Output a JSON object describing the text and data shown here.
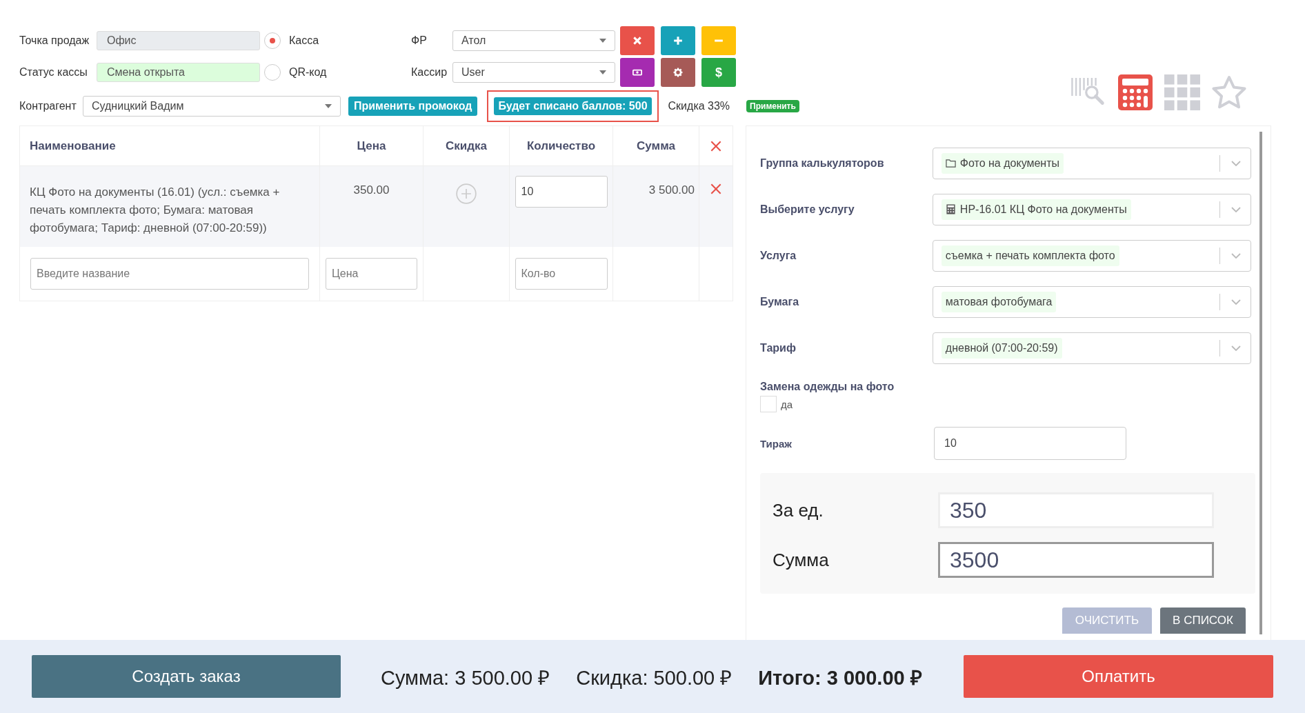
{
  "point_of_sale": {
    "label": "Точка продаж",
    "value": "Офис"
  },
  "register_status": {
    "label": "Статус кассы",
    "value": "Смена открыта"
  },
  "payment_modes": [
    {
      "label": "Касса",
      "selected": true
    },
    {
      "label": "QR-код",
      "selected": false
    }
  ],
  "fiscal": {
    "label": "ФР",
    "value": "Атол"
  },
  "cashier": {
    "label": "Кассир",
    "value": "User"
  },
  "tool_buttons": [
    {
      "kind": "close",
      "color": "#e8524a"
    },
    {
      "kind": "plus",
      "color": "#17a2b8"
    },
    {
      "kind": "minus",
      "color": "#ffc107"
    },
    {
      "kind": "cash",
      "color": "#a52bb0"
    },
    {
      "kind": "gear",
      "color": "#a65a57"
    },
    {
      "kind": "text",
      "label": "$",
      "color": "#28a745"
    }
  ],
  "counterparty": {
    "label": "Контрагент",
    "value": "Судницкий Вадим"
  },
  "promo_button": "Применить промокод",
  "points_badge": "Будет списано баллов: 500",
  "discount_text": "Скидка 33%",
  "apply_button": "Применить",
  "view_icons": [
    {
      "kind": "barcode-search",
      "selected": false
    },
    {
      "kind": "calculator",
      "selected": true
    },
    {
      "kind": "grid",
      "selected": false
    },
    {
      "kind": "star",
      "selected": false
    }
  ],
  "table": {
    "columns": [
      "Наименование",
      "Цена",
      "Скидка",
      "Количество",
      "Сумма"
    ],
    "rows": [
      {
        "name": "КЦ Фото на документы (16.01) (усл.: съемка + печать комплекта фото; Бумага: матовая фотобумага; Тариф: дневной (07:00-20:59))",
        "price": "350.00",
        "quantity": "10",
        "sum": "3 500.00"
      }
    ],
    "new_row": {
      "name_placeholder": "Введите название",
      "price_placeholder": "Цена",
      "quantity_placeholder": "Кол-во"
    }
  },
  "calculator": {
    "fields": [
      {
        "label": "Группа калькуляторов",
        "value": "Фото на документы",
        "kind": "folder"
      },
      {
        "label": "Выберите услугу",
        "value": "НР-16.01 КЦ Фото на документы",
        "kind": "calculator"
      },
      {
        "label": "Услуга",
        "value": "съемка + печать комплекта фото",
        "kind": "plain"
      },
      {
        "label": "Бумага",
        "value": "матовая фотобумага",
        "kind": "plain"
      },
      {
        "label": "Тариф",
        "value": "дневной (07:00-20:59)",
        "kind": "plain"
      }
    ],
    "option": {
      "label": "Замена одежды на фото",
      "checkbox_label": "да",
      "checked": false
    },
    "run": {
      "label": "Тираж",
      "value": "10"
    },
    "unit_price": {
      "label": "За ед.",
      "value": "350"
    },
    "total": {
      "label": "Сумма",
      "value": "3500"
    },
    "clear_button": "ОЧИСТИТЬ",
    "add_button": "В СПИСОК"
  },
  "footer": {
    "create_button": "Создать заказ",
    "totals": [
      {
        "text": "Сумма: 3 500.00 ₽",
        "emphasis": false
      },
      {
        "text": "Скидка: 500.00 ₽",
        "emphasis": false
      },
      {
        "text": "Итого: 3 000.00 ₽",
        "emphasis": true
      }
    ],
    "pay_button": "Оплатить"
  }
}
